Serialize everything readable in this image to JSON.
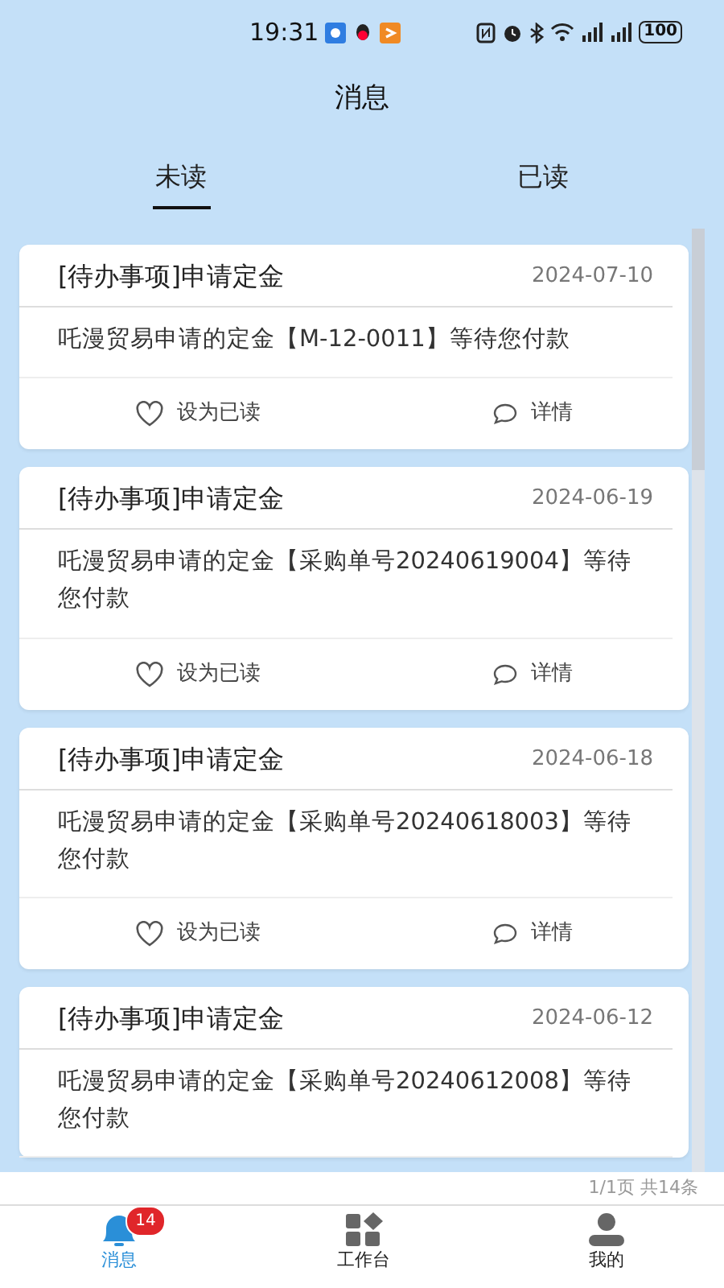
{
  "status_bar": {
    "time": "19:31",
    "battery": "100"
  },
  "header": {
    "title": "消息"
  },
  "tabs": [
    {
      "label": "未读",
      "selected": true
    },
    {
      "label": "已读",
      "selected": false
    }
  ],
  "messages": [
    {
      "title": "[待办事项]申请定金",
      "date": "2024-07-10",
      "body": "吒漫贸易申请的定金【M-12-0011】等待您付款",
      "actions": [
        "设为已读",
        "详情"
      ]
    },
    {
      "title": "[待办事项]申请定金",
      "date": "2024-06-19",
      "body": "吒漫贸易申请的定金【采购单号20240619004】等待您付款",
      "actions": [
        "设为已读",
        "详情"
      ]
    },
    {
      "title": "[待办事项]申请定金",
      "date": "2024-06-18",
      "body": "吒漫贸易申请的定金【采购单号20240618003】等待您付款",
      "actions": [
        "设为已读",
        "详情"
      ]
    },
    {
      "title": "[待办事项]申请定金",
      "date": "2024-06-12",
      "body": "吒漫贸易申请的定金【采购单号20240612008】等待您付款"
    }
  ],
  "pager": "1/1页 共14条",
  "bottom_nav": [
    {
      "kind": "messages",
      "label": "消息",
      "badge": "14",
      "selected": true
    },
    {
      "kind": "workbench",
      "label": "工作台",
      "selected": false
    },
    {
      "kind": "profile",
      "label": "我的",
      "selected": false
    }
  ]
}
